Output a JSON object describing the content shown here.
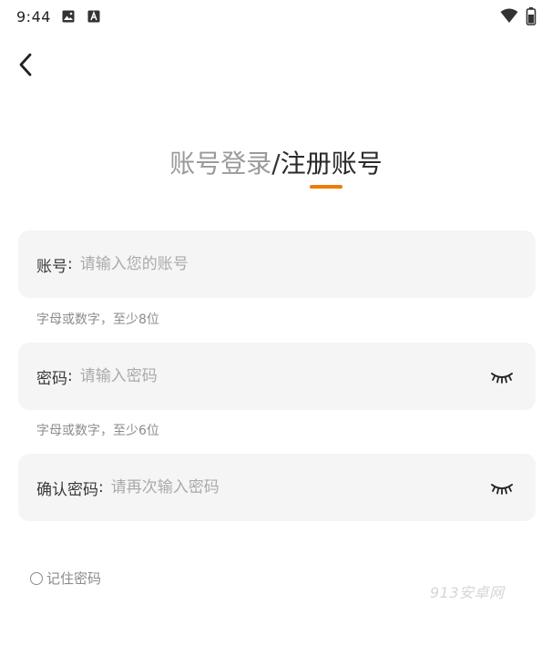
{
  "status_bar": {
    "time": "9:44"
  },
  "header": {
    "tab_login": "账号登录",
    "separator": "/",
    "tab_register": "注册账号",
    "accent_color": "#f07b00"
  },
  "form": {
    "account": {
      "label": "账号",
      "colon": ":",
      "placeholder": "请输入您的账号",
      "hint": "字母或数字，至少8位"
    },
    "password": {
      "label": "密码",
      "colon": ":",
      "placeholder": "请输入密码",
      "hint": "字母或数字，至少6位"
    },
    "confirm_password": {
      "label": "确认密码",
      "colon": ":",
      "placeholder": "请再次输入密码"
    },
    "remember_label": "记住密码"
  },
  "watermark": "913安卓网",
  "icons": {
    "back": "back-arrow-icon",
    "eye": "eye-closed-icon",
    "wifi": "wifi-icon",
    "battery": "battery-icon",
    "gallery": "gallery-icon"
  }
}
